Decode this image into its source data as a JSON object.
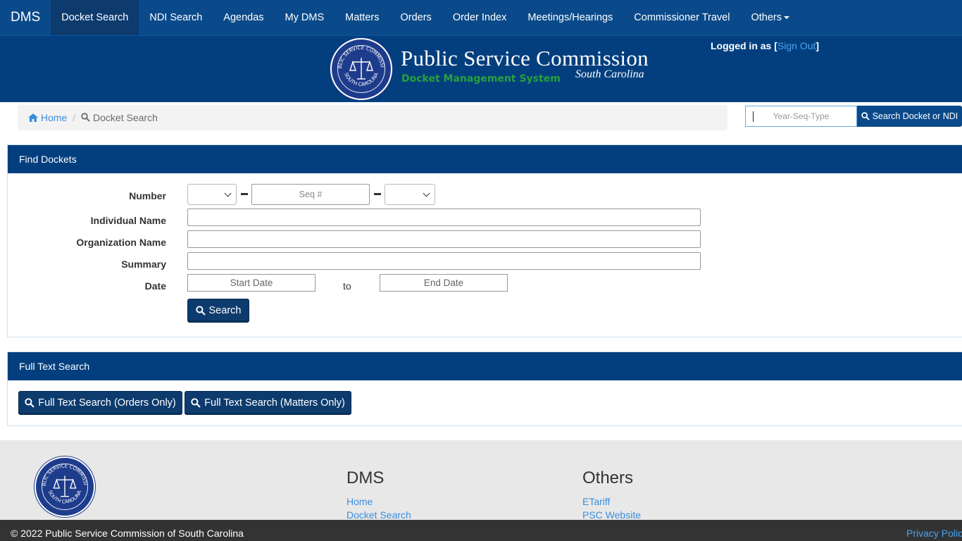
{
  "navbar": {
    "brand": "DMS",
    "items": [
      {
        "label": "Docket Search"
      },
      {
        "label": "NDI Search"
      },
      {
        "label": "Agendas"
      },
      {
        "label": "My DMS"
      },
      {
        "label": "Matters"
      },
      {
        "label": "Orders"
      },
      {
        "label": "Order Index"
      },
      {
        "label": "Meetings/Hearings"
      },
      {
        "label": "Commissioner Travel"
      },
      {
        "label": "Others"
      }
    ],
    "active": "Docket Search"
  },
  "banner": {
    "title": "Public Service Commission",
    "subtitle": "Docket Management System",
    "state": "South Carolina",
    "seal_top_text": "PUBLIC SERVICE COMMISSION",
    "seal_bottom_text": "SOUTH CAROLINA",
    "login_prefix": "Logged in as [",
    "sign_out": "Sign Out",
    "login_suffix": "]"
  },
  "breadcrumb": {
    "home": "Home",
    "separator": "/",
    "current": "Docket Search"
  },
  "quick_search": {
    "placeholder": "Year-Seq-Type",
    "button": "Search Docket or NDI"
  },
  "find_dockets": {
    "heading": "Find Dockets",
    "labels": {
      "number": "Number",
      "individual_name": "Individual Name",
      "organization_name": "Organization Name",
      "summary": "Summary",
      "date": "Date"
    },
    "seq_placeholder": "Seq #",
    "start_date": "Start Date",
    "to": "to",
    "end_date": "End Date",
    "search_button": "Search"
  },
  "full_text": {
    "heading": "Full Text Search",
    "orders_button": "Full Text Search (Orders Only)",
    "matters_button": "Full Text Search (Matters Only)"
  },
  "footer": {
    "dms_heading": "DMS",
    "dms_links": [
      "Home",
      "Docket Search"
    ],
    "others_heading": "Others",
    "others_links": [
      "ETariff",
      "PSC Website"
    ],
    "copyright": "© 2022 Public Service Commission of South Carolina",
    "privacy": "Privacy Policy"
  },
  "colors": {
    "navbar": "#0a4a8a",
    "banner": "#033f7e",
    "panel_heading": "#033f7e",
    "link": "#3a8ee0",
    "subtitle_green": "#27a13a"
  }
}
